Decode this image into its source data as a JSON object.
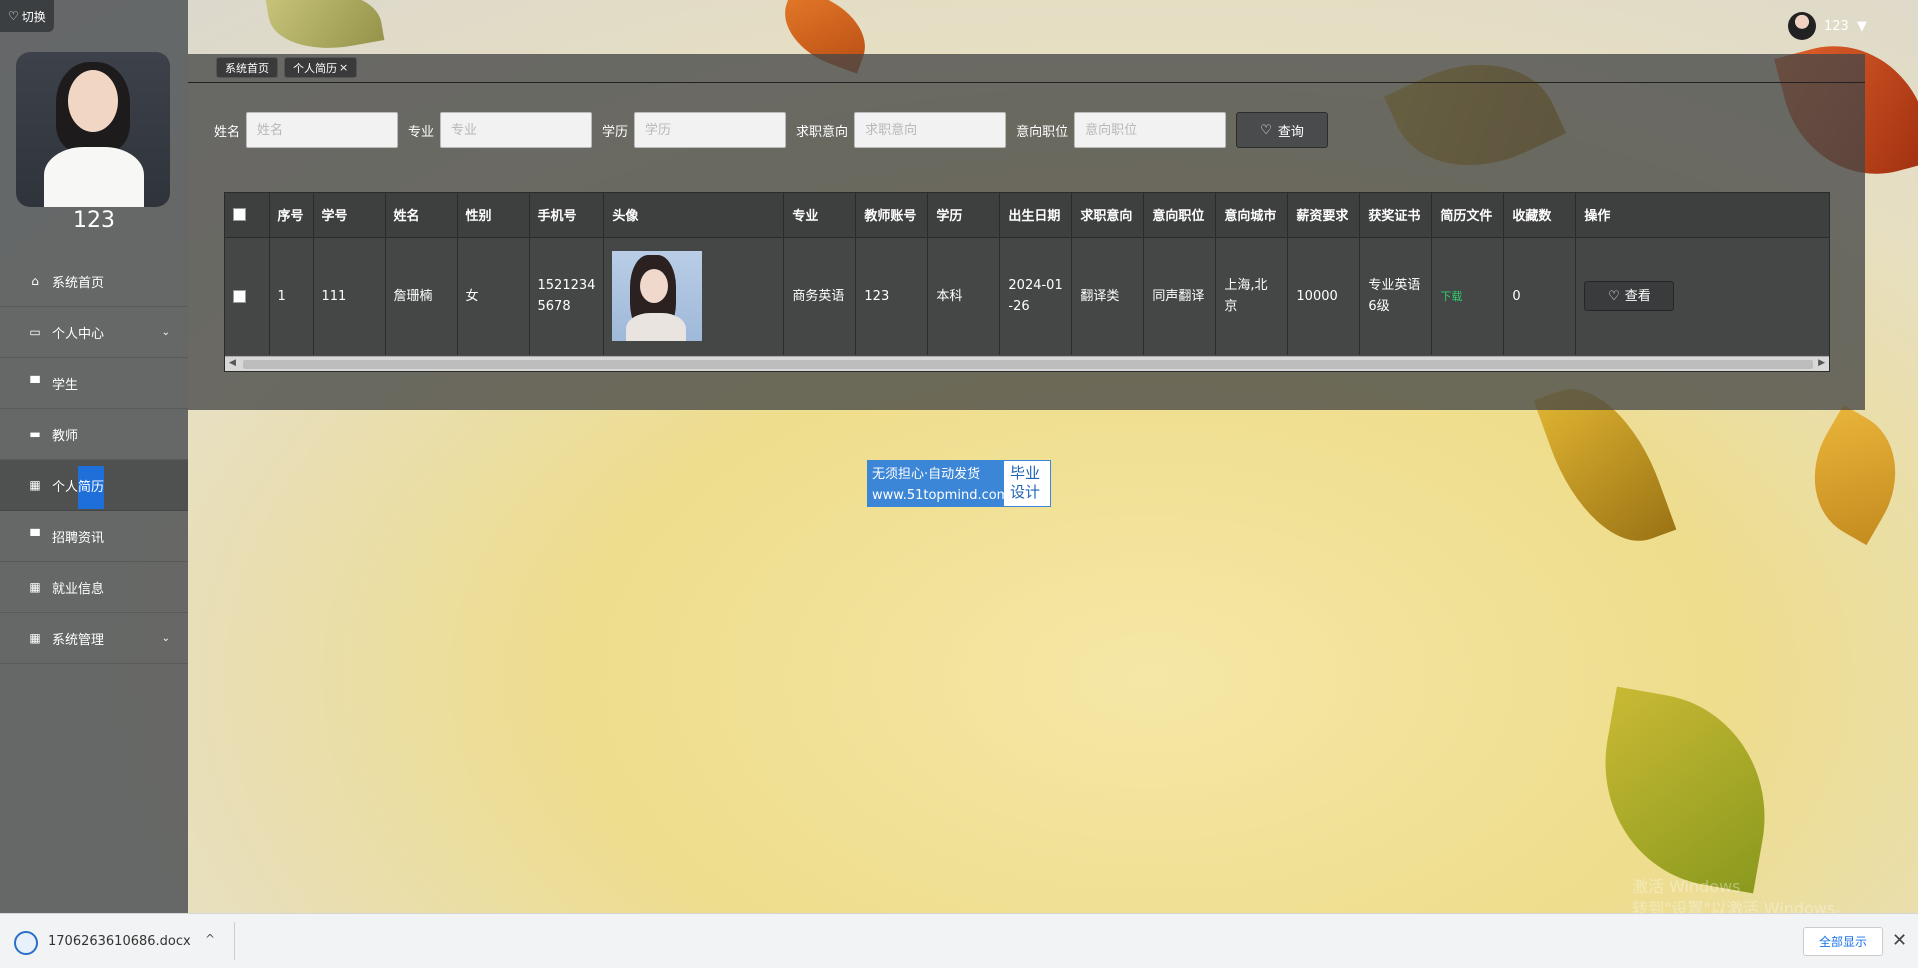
{
  "colors": {
    "accent": "#3b86d6",
    "link_green": "#2ecc71",
    "highlight": "#1e6fd9"
  },
  "sidebar": {
    "switch_label": "切换",
    "switch_icon": "heart-icon",
    "profile_name": "123",
    "items": [
      {
        "label": "系统首页",
        "icon": "home-icon"
      },
      {
        "label": "个人中心",
        "icon": "profile-icon",
        "has_submenu": true
      },
      {
        "label": "学生",
        "icon": "monitor-icon"
      },
      {
        "label": "教师",
        "icon": "chat-icon"
      },
      {
        "label_a": "个人",
        "label_b": "简历",
        "icon": "grid-icon",
        "active": true
      },
      {
        "label": "招聘资讯",
        "icon": "news-icon"
      },
      {
        "label": "就业信息",
        "icon": "grid-icon"
      },
      {
        "label": "系统管理",
        "icon": "grid-icon",
        "has_submenu": true
      }
    ]
  },
  "header": {
    "username": "123"
  },
  "tabs": [
    {
      "label": "系统首页"
    },
    {
      "label": "个人简历",
      "close": "×"
    }
  ],
  "search": {
    "fields": [
      {
        "label": "姓名",
        "placeholder": "姓名"
      },
      {
        "label": "专业",
        "placeholder": "专业"
      },
      {
        "label": "学历",
        "placeholder": "学历"
      },
      {
        "label": "求职意向",
        "placeholder": "求职意向"
      },
      {
        "label": "意向职位",
        "placeholder": "意向职位"
      }
    ],
    "button_label": "查询"
  },
  "table": {
    "headers": [
      "序号",
      "学号",
      "姓名",
      "性别",
      "手机号",
      "头像",
      "专业",
      "教师账号",
      "学历",
      "出生日期",
      "求职意向",
      "意向职位",
      "意向城市",
      "薪资要求",
      "获奖证书",
      "简历文件",
      "收藏数",
      "操作"
    ],
    "rows": [
      {
        "index": "1",
        "student_no": "111",
        "name": "詹珊楠",
        "gender": "女",
        "phone_a": "1521234",
        "phone_b": "5678",
        "major": "商务英语",
        "teacher": "123",
        "education": "本科",
        "birth_a": "2024-01",
        "birth_b": "-26",
        "intent": "翻译类",
        "position": "同声翻译",
        "city_a": "上海,北",
        "city_b": "京",
        "salary": "10000",
        "award_a": "专业英语",
        "award_b": "6级",
        "resume": "下载",
        "favorites": "0",
        "action": "查看"
      }
    ]
  },
  "badge": {
    "line1": "无须担心·自动发货",
    "line2": "www.51topmind.com",
    "right1": "毕业",
    "right2": "设计"
  },
  "watermark": {
    "line1": "激活 Windows",
    "line2": "转到\"设置\"以激活 Windows。"
  },
  "download_bar": {
    "file": "1706263610686.docx",
    "show_all": "全部显示",
    "close": "✕",
    "chevron": "^"
  }
}
